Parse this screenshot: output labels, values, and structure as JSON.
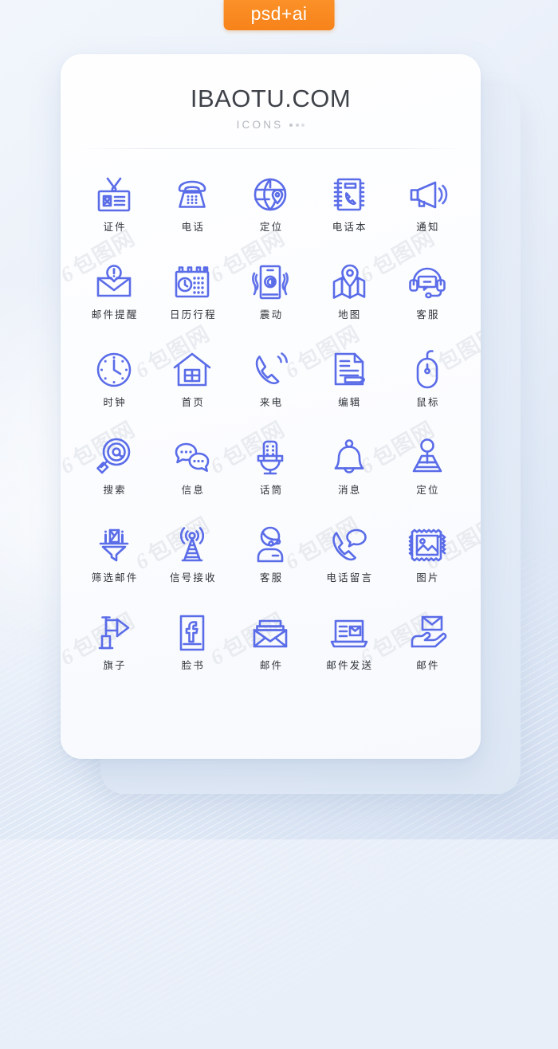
{
  "badge": {
    "label": "psd+ai",
    "color": "#f7821a"
  },
  "header": {
    "title": "IBAOTU.COM",
    "subtitle": "ICONS",
    "dots_count": 3
  },
  "theme": {
    "icon_color": "#5a6ce8",
    "card_background": "#fdfeff",
    "page_background": "#e9eff8",
    "label_color": "#2f3338",
    "title_color": "#3f4349",
    "subtitle_color": "#b3b7bd"
  },
  "watermark": {
    "text": "包图网",
    "prefix": "6"
  },
  "grid": {
    "columns": 5,
    "rows": 6,
    "icons": [
      {
        "label": "证件",
        "icon": "id-card-icon"
      },
      {
        "label": "电话",
        "icon": "telephone-icon"
      },
      {
        "label": "定位",
        "icon": "globe-location-icon"
      },
      {
        "label": "电话本",
        "icon": "phone-book-icon"
      },
      {
        "label": "通知",
        "icon": "megaphone-icon"
      },
      {
        "label": "邮件提醒",
        "icon": "mail-alert-icon"
      },
      {
        "label": "日历行程",
        "icon": "calendar-clock-icon"
      },
      {
        "label": "震动",
        "icon": "phone-vibrate-icon"
      },
      {
        "label": "地图",
        "icon": "map-pin-icon"
      },
      {
        "label": "客服",
        "icon": "headset-support-icon"
      },
      {
        "label": "时钟",
        "icon": "clock-icon"
      },
      {
        "label": "首页",
        "icon": "home-icon"
      },
      {
        "label": "来电",
        "icon": "incoming-call-icon"
      },
      {
        "label": "编辑",
        "icon": "edit-document-icon"
      },
      {
        "label": "鼠标",
        "icon": "mouse-icon"
      },
      {
        "label": "搜索",
        "icon": "search-at-icon"
      },
      {
        "label": "信息",
        "icon": "chat-bubbles-icon"
      },
      {
        "label": "话筒",
        "icon": "microphone-icon"
      },
      {
        "label": "消息",
        "icon": "bell-icon"
      },
      {
        "label": "定位",
        "icon": "map-marker-pin-icon"
      },
      {
        "label": "筛选邮件",
        "icon": "mail-filter-icon"
      },
      {
        "label": "信号接收",
        "icon": "signal-tower-icon"
      },
      {
        "label": "客服",
        "icon": "operator-agent-icon"
      },
      {
        "label": "电话留言",
        "icon": "voicemail-icon"
      },
      {
        "label": "图片",
        "icon": "photo-stamp-icon"
      },
      {
        "label": "旗子",
        "icon": "flag-icon"
      },
      {
        "label": "脸书",
        "icon": "facebook-icon"
      },
      {
        "label": "邮件",
        "icon": "envelope-icon"
      },
      {
        "label": "邮件发送",
        "icon": "laptop-mail-icon"
      },
      {
        "label": "邮件",
        "icon": "hand-mail-icon"
      }
    ]
  }
}
